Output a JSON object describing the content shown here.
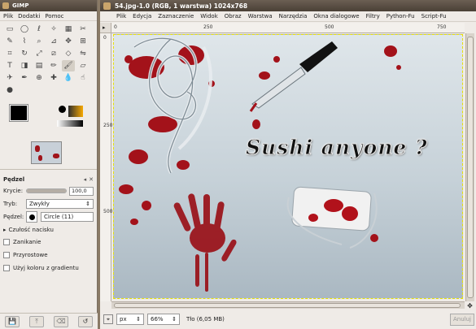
{
  "toolbox": {
    "title": "GIMP",
    "menu": [
      "Plik",
      "Dodatki",
      "Pomoc"
    ],
    "tools": [
      "rect-select-icon",
      "ellipse-select-icon",
      "free-select-icon",
      "fuzzy-select-icon",
      "color-select-icon",
      "scissors-icon",
      "paths-icon",
      "color-picker-icon",
      "zoom-icon",
      "measure-icon",
      "move-icon",
      "align-icon",
      "crop-icon",
      "rotate-icon",
      "scale-icon",
      "shear-icon",
      "perspective-icon",
      "flip-icon",
      "text-icon",
      "bucket-fill-icon",
      "blend-icon",
      "pencil-icon",
      "paintbrush-icon",
      "eraser-icon",
      "airbrush-icon",
      "ink-icon",
      "clone-icon",
      "heal-icon",
      "blur-icon",
      "smudge-icon",
      "dodge-icon"
    ],
    "active_tool_index": 22,
    "fg_color": "#000000",
    "bg_color": "#ffffff",
    "tool_options": {
      "title": "Pędzel",
      "opacity_label": "Krycie:",
      "opacity_value": "100,0",
      "mode_label": "Tryb:",
      "mode_value": "Zwykły",
      "brush_label": "Pędzel:",
      "brush_value": "Circle (11)",
      "pressure_label": "Czułość nacisku",
      "options": [
        "Zanikanie",
        "Przyrostowe",
        "Użyj koloru z gradientu"
      ]
    }
  },
  "image_window": {
    "title": "54.jpg-1.0 (RGB, 1 warstwa) 1024x768",
    "menu": [
      "Plik",
      "Edycja",
      "Zaznaczenie",
      "Widok",
      "Obraz",
      "Warstwa",
      "Narzędzia",
      "Okna dialogowe",
      "Filtry",
      "Python-Fu",
      "Script-Fu"
    ],
    "ruler_top_labels": [
      "0",
      "250",
      "500",
      "750"
    ],
    "ruler_left_labels": [
      "0",
      "250",
      "500"
    ],
    "canvas_text": "Sushi anyone ?",
    "status": {
      "unit": "px",
      "zoom": "66%",
      "layer_info": "Tło (6,05 MB)",
      "cancel_label": "Anuluj"
    }
  }
}
